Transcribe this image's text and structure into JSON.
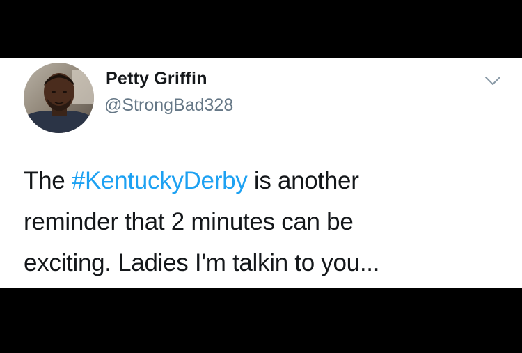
{
  "colors": {
    "background": "#000000",
    "card": "#ffffff",
    "text": "#14171a",
    "handle": "#657786",
    "hashtag": "#1da1f2"
  },
  "tweet": {
    "author": {
      "display_name": "Petty Griffin",
      "handle": "@StrongBad328",
      "avatar_icon": "profile-photo"
    },
    "menu_icon": "chevron-down-icon",
    "text": {
      "line1_before": "The ",
      "hashtag": "#KentuckyDerby",
      "line1_after": " is another",
      "line2": "reminder that 2 minutes can be",
      "line3": "exciting. Ladies I'm talkin to you..."
    }
  }
}
